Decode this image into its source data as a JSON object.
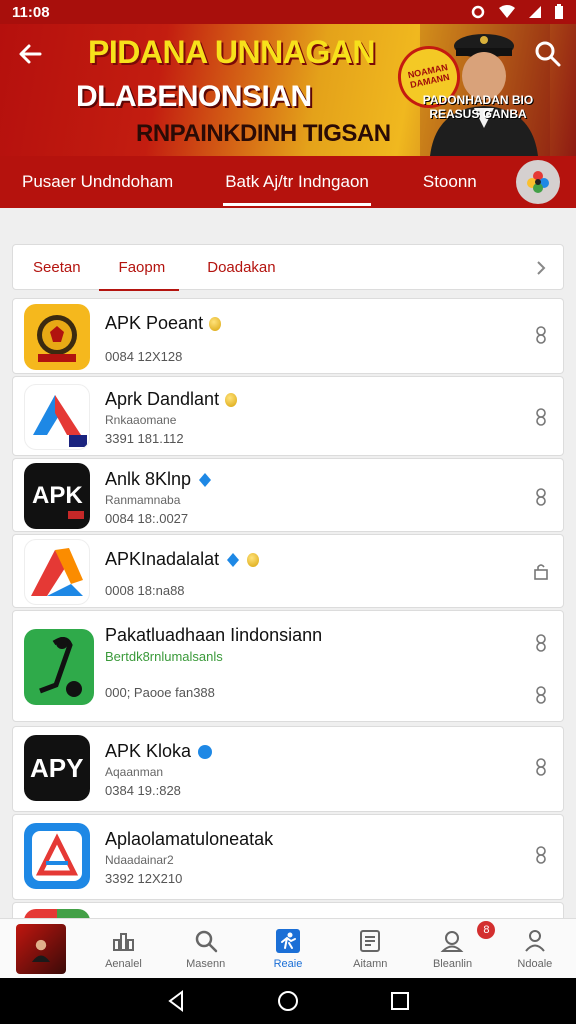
{
  "status_bar": {
    "time": "11:08"
  },
  "banner": {
    "title_line1": "PIDANA UNNAGAN",
    "title_line2": "DLABENONSIAN",
    "title_line3": "RNPAINKDINH TIGSAN",
    "sticker_text": "NOAMAN DAMANN",
    "person_caption": "PADONHADAN BIO REASUS GANBA"
  },
  "main_tabs": [
    {
      "label": "Pusaer Undndoham",
      "active": false
    },
    {
      "label": "Batk Aj/tr Indngaon",
      "active": true
    },
    {
      "label": "Stoonn",
      "active": false
    }
  ],
  "sub_tabs": [
    {
      "label": "Seetan",
      "active": false
    },
    {
      "label": "Faopm",
      "active": true
    },
    {
      "label": "Doadakan",
      "active": false
    }
  ],
  "apps": [
    {
      "name": "APK Poeant",
      "subtitle": "",
      "meta": "0084 12X128",
      "badge": "coin",
      "action": "download-icon"
    },
    {
      "name": "Aprk Dandlant",
      "subtitle": "Rnkaaomane",
      "meta": "3391 181.112",
      "badge": "coin",
      "action": "download-icon"
    },
    {
      "name": "Anlk 8Klnp",
      "subtitle": "Ranmamnaba",
      "meta": "0084 18:.0027",
      "badge": "verified",
      "action": "download-icon"
    },
    {
      "name": "APKInadalalat",
      "subtitle": "",
      "meta": "0008 18:na88",
      "badge": "verified-coin",
      "action": "lock-icon"
    },
    {
      "name": "Pakatluadhaan Iindonsiann",
      "subtitle": "Bertdk8rnlumalsanls",
      "meta": "000; Paooe fan388",
      "badge": "",
      "action": "download-icon"
    },
    {
      "name": "APK Kloka",
      "subtitle": "Aqaanman",
      "meta": "0384 19.:828",
      "badge": "verified",
      "action": "download-icon"
    },
    {
      "name": "Aplaolamatuloneatak",
      "subtitle": "Ndaadainar2",
      "meta": "3392 12X210",
      "badge": "",
      "action": "download-icon"
    }
  ],
  "bottom_nav": [
    {
      "label": "",
      "icon": "avatar"
    },
    {
      "label": "Aenalel",
      "icon": "stats-icon"
    },
    {
      "label": "Masenn",
      "icon": "search-icon"
    },
    {
      "label": "Reaie",
      "icon": "runner-icon",
      "active": true
    },
    {
      "label": "Aitamn",
      "icon": "document-icon"
    },
    {
      "label": "Bleanlin",
      "icon": "profile-card-icon",
      "badge_count": "8"
    },
    {
      "label": "Ndoale",
      "icon": "user-icon"
    }
  ],
  "colors": {
    "brand_red": "#b5120d",
    "accent_blue": "#1b6fd6"
  }
}
